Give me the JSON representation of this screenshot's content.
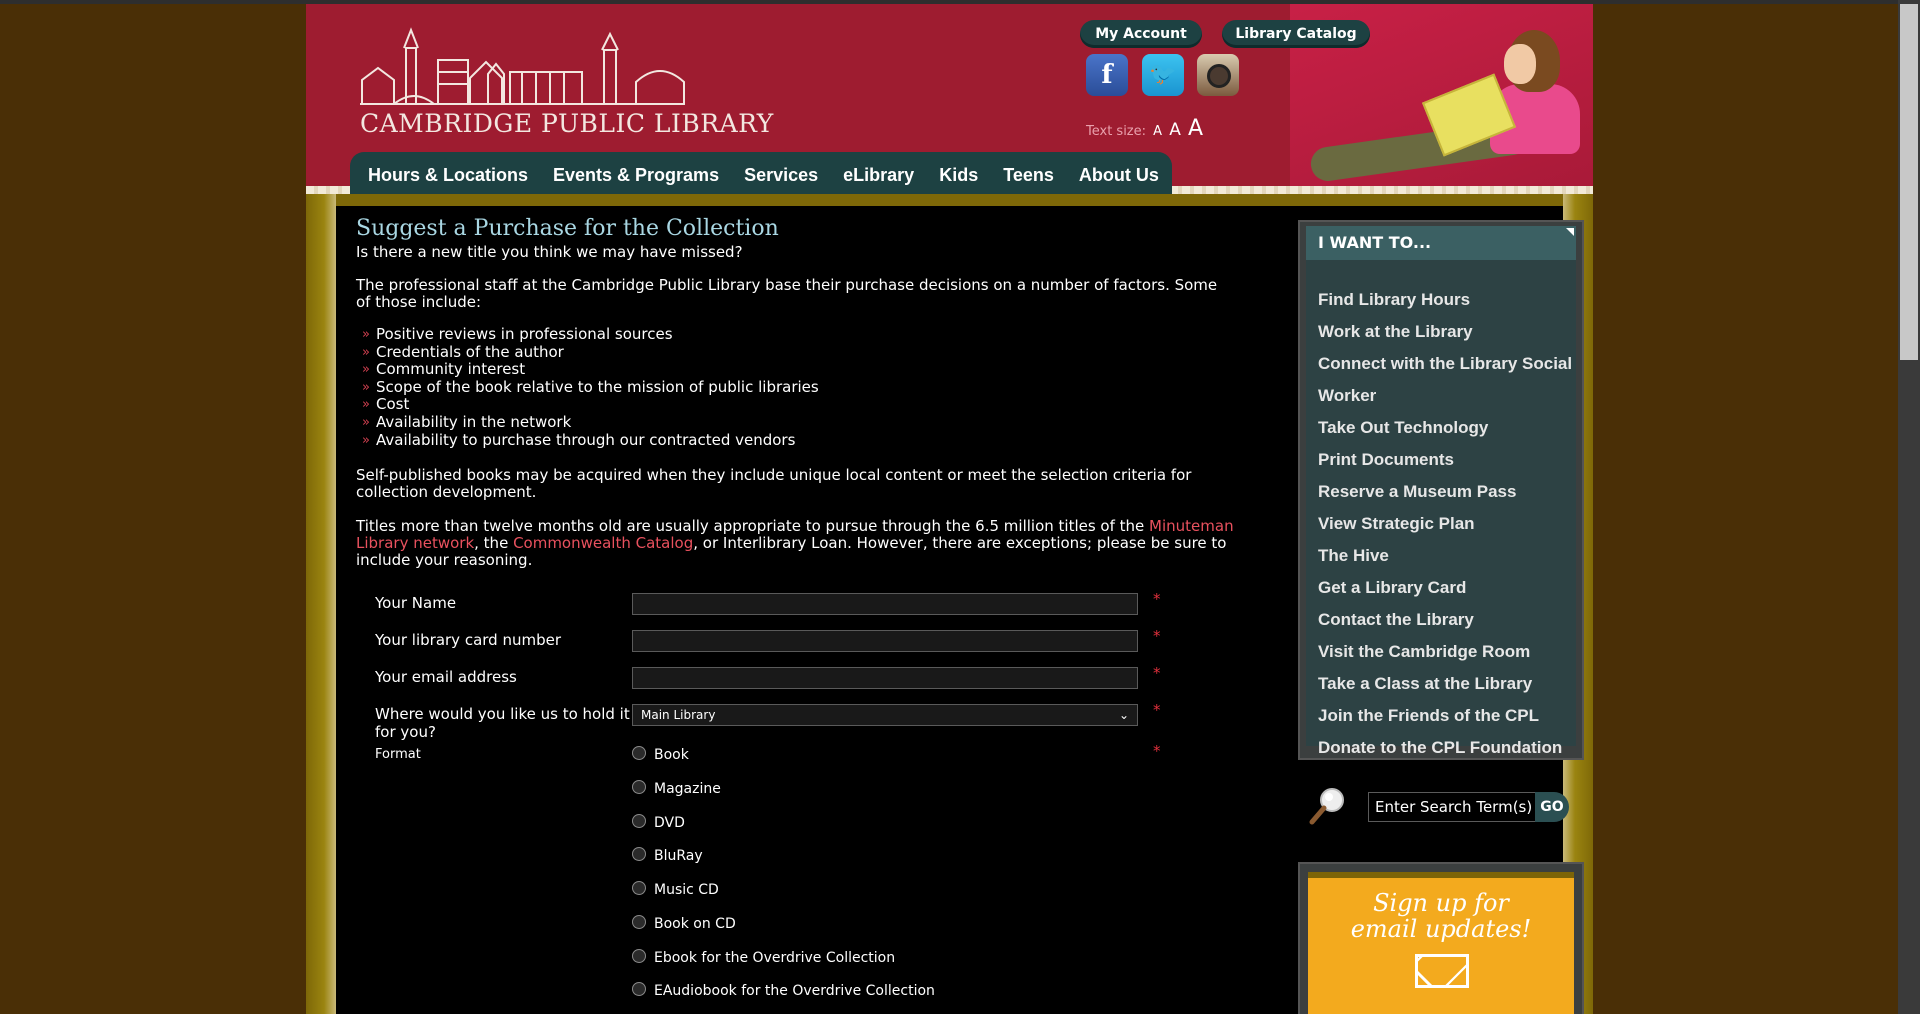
{
  "header": {
    "logo_text": "CAMBRIDGE PUBLIC LIBRARY",
    "my_account": "My Account",
    "library_catalog": "Library Catalog",
    "text_size_label": "Text size:",
    "text_size_options": [
      "A",
      "A",
      "A"
    ],
    "social_icons": [
      "facebook-icon",
      "twitter-icon",
      "instagram-icon"
    ]
  },
  "nav": [
    "Hours & Locations",
    "Events & Programs",
    "Services",
    "eLibrary",
    "Kids",
    "Teens",
    "About Us"
  ],
  "content": {
    "title": "Suggest a Purchase for the Collection",
    "intro": "Is there a new title you think we may have missed?",
    "staff": "The professional staff at the Cambridge Public Library base their purchase decisions on a number of factors. Some of those include:",
    "factors": [
      "Positive reviews in professional sources",
      "Credentials of the author",
      "Community interest",
      "Scope of the book relative to the mission of public libraries",
      "Cost",
      "Availability in the network",
      "Availability to purchase through our contracted vendors"
    ],
    "self_published": "Self-published books may be acquired when they include unique local content or meet the selection criteria for collection development.",
    "titles_p1": "Titles more than twelve months old are usually appropriate to pursue through the 6.5 million titles of the ",
    "titles_link1": "Minuteman Library network",
    "titles_p2": ", the ",
    "titles_link2": "Commonwealth Catalog",
    "titles_p3": ", or Interlibrary Loan. However, there are exceptions; please be sure to include your reasoning."
  },
  "form": {
    "name_label": "Your Name",
    "card_label": "Your library card number",
    "email_label": "Your email address",
    "hold_label": "Where would you like us to hold it for you?",
    "hold_value": "Main Library",
    "format_label": "Format",
    "required_mark": "*",
    "formats": [
      "Book",
      "Magazine",
      "DVD",
      "BluRay",
      "Music CD",
      "Book on CD",
      "Ebook for the Overdrive Collection",
      "EAudiobook for the Overdrive Collection"
    ]
  },
  "sidebar": {
    "title": "I WANT TO...",
    "items": [
      "Find Library Hours",
      "Work at the Library",
      "Connect with the Library Social",
      "Worker",
      "Take Out Technology",
      "Print Documents",
      "Reserve a Museum Pass",
      "View Strategic Plan",
      "The Hive",
      "Get a Library Card",
      "Contact the Library",
      "Visit the Cambridge Room",
      "Take a Class at the Library",
      "Join the Friends of the CPL",
      "Donate to the CPL Foundation"
    ]
  },
  "search": {
    "placeholder": "Enter Search Term(s)",
    "go": "GO"
  },
  "signup": {
    "line1": "Sign up for",
    "line2": "email updates!"
  }
}
